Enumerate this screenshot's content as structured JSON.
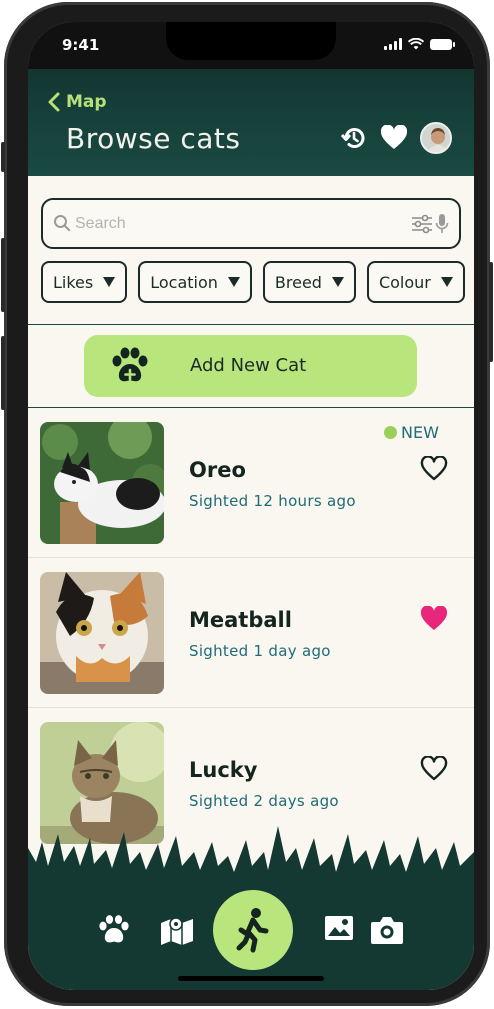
{
  "status_bar": {
    "time": "9:41"
  },
  "header": {
    "back_label": "Map",
    "title": "Browse cats"
  },
  "search": {
    "placeholder": "Search"
  },
  "filters": [
    {
      "label": "Likes"
    },
    {
      "label": "Location"
    },
    {
      "label": "Breed"
    },
    {
      "label": "Colour"
    }
  ],
  "add_button": {
    "label": "Add New Cat"
  },
  "cats": [
    {
      "name": "Oreo",
      "sighted": "Sighted 12 hours ago",
      "badge": "NEW",
      "liked": false
    },
    {
      "name": "Meatball",
      "sighted": "Sighted 1 day ago",
      "liked": true
    },
    {
      "name": "Lucky",
      "sighted": "Sighted 2 days ago",
      "liked": false
    }
  ],
  "bottom_nav": {
    "items": [
      "paw-icon",
      "map-icon",
      "walking-icon",
      "image-icon",
      "camera-icon"
    ],
    "active": "walking-icon"
  },
  "colors": {
    "header": "#16403a",
    "accent_green": "#b9e67c",
    "teal_text": "#1f6b78",
    "liked_heart": "#e8267a",
    "nav": "#143832"
  }
}
